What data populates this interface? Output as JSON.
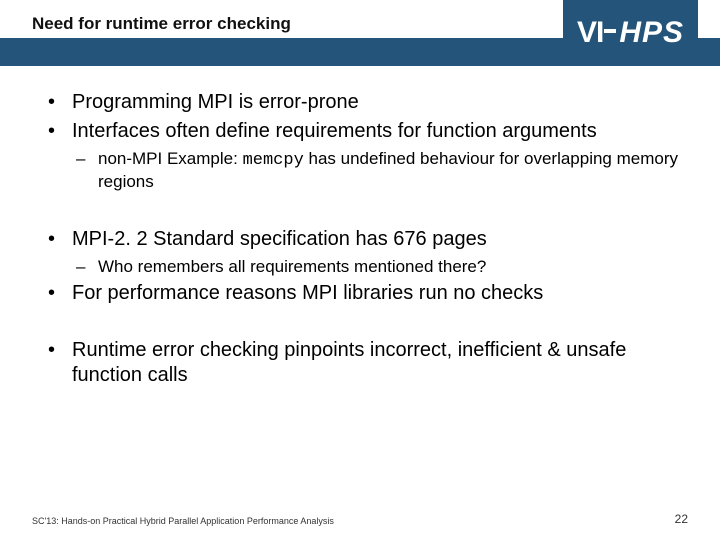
{
  "header": {
    "title": "Need for runtime error checking",
    "logo_vi": "VI",
    "logo_hps": "HPS"
  },
  "bullets": {
    "b1": "Programming MPI is error-prone",
    "b2": "Interfaces often define requirements for function arguments",
    "b2_sub1_pre": "non-MPI Example: ",
    "b2_sub1_code": "memcpy",
    "b2_sub1_post": " has undefined behaviour for overlapping memory regions",
    "b3": "MPI-2. 2 Standard specification has 676 pages",
    "b3_sub1": "Who remembers all requirements mentioned there?",
    "b4": "For performance reasons MPI libraries run no checks",
    "b5": "Runtime error checking pinpoints incorrect, inefficient & unsafe function calls"
  },
  "footer": {
    "left": "SC'13: Hands-on Practical Hybrid Parallel Application Performance Analysis",
    "page": "22"
  }
}
